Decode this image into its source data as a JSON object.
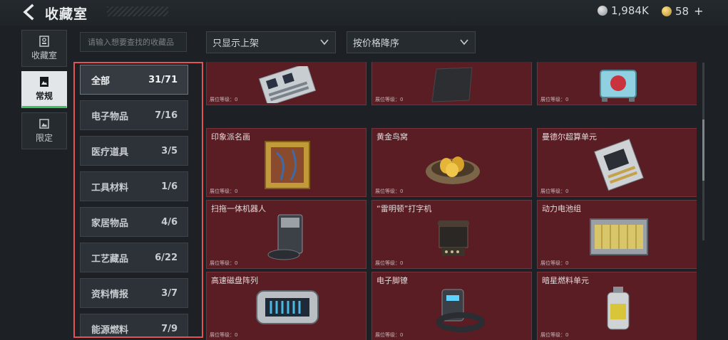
{
  "header": {
    "title": "收藏室",
    "silver_amount": "1,984K",
    "gold_amount": "58",
    "plus": "+"
  },
  "leftnav": [
    {
      "label": "收藏室",
      "icon": "collection-icon"
    },
    {
      "label": "常规",
      "icon": "picture-icon"
    },
    {
      "label": "限定",
      "icon": "picture-icon"
    }
  ],
  "search": {
    "placeholder": "请输入想要查找的收藏品"
  },
  "filters": {
    "shelf": "只显示上架",
    "sort": "按价格降序"
  },
  "categories": [
    {
      "label": "全部",
      "count": "31/71"
    },
    {
      "label": "电子物品",
      "count": "7/16"
    },
    {
      "label": "医疗道具",
      "count": "3/5"
    },
    {
      "label": "工具材料",
      "count": "1/6"
    },
    {
      "label": "家居物品",
      "count": "4/6"
    },
    {
      "label": "工艺藏品",
      "count": "6/22"
    },
    {
      "label": "资料情报",
      "count": "3/7"
    },
    {
      "label": "能源燃料",
      "count": "7/9"
    }
  ],
  "level_label": "展位等级：0",
  "items": [
    {
      "name": "",
      "icon": "server-board-icon"
    },
    {
      "name": "",
      "icon": "dark-plate-icon"
    },
    {
      "name": "",
      "icon": "machine-core-icon"
    },
    {
      "name": "印象派名画",
      "icon": "painting-icon"
    },
    {
      "name": "黄金鸟窝",
      "icon": "golden-nest-icon"
    },
    {
      "name": "曼德尔超算单元",
      "icon": "supercomputer-unit-icon"
    },
    {
      "name": "扫拖一体机器人",
      "icon": "robot-vacuum-icon"
    },
    {
      "name": "“雷明顿”打字机",
      "icon": "typewriter-icon"
    },
    {
      "name": "动力电池组",
      "icon": "battery-pack-icon"
    },
    {
      "name": "高速磁盘阵列",
      "icon": "disk-array-icon"
    },
    {
      "name": "电子脚镣",
      "icon": "ankle-monitor-icon"
    },
    {
      "name": "暗星燃料单元",
      "icon": "fuel-canister-icon"
    }
  ],
  "colors": {
    "card_bg": "#5a1d24",
    "highlight_border": "#e25454",
    "active_tab_underline": "#39c55a"
  }
}
